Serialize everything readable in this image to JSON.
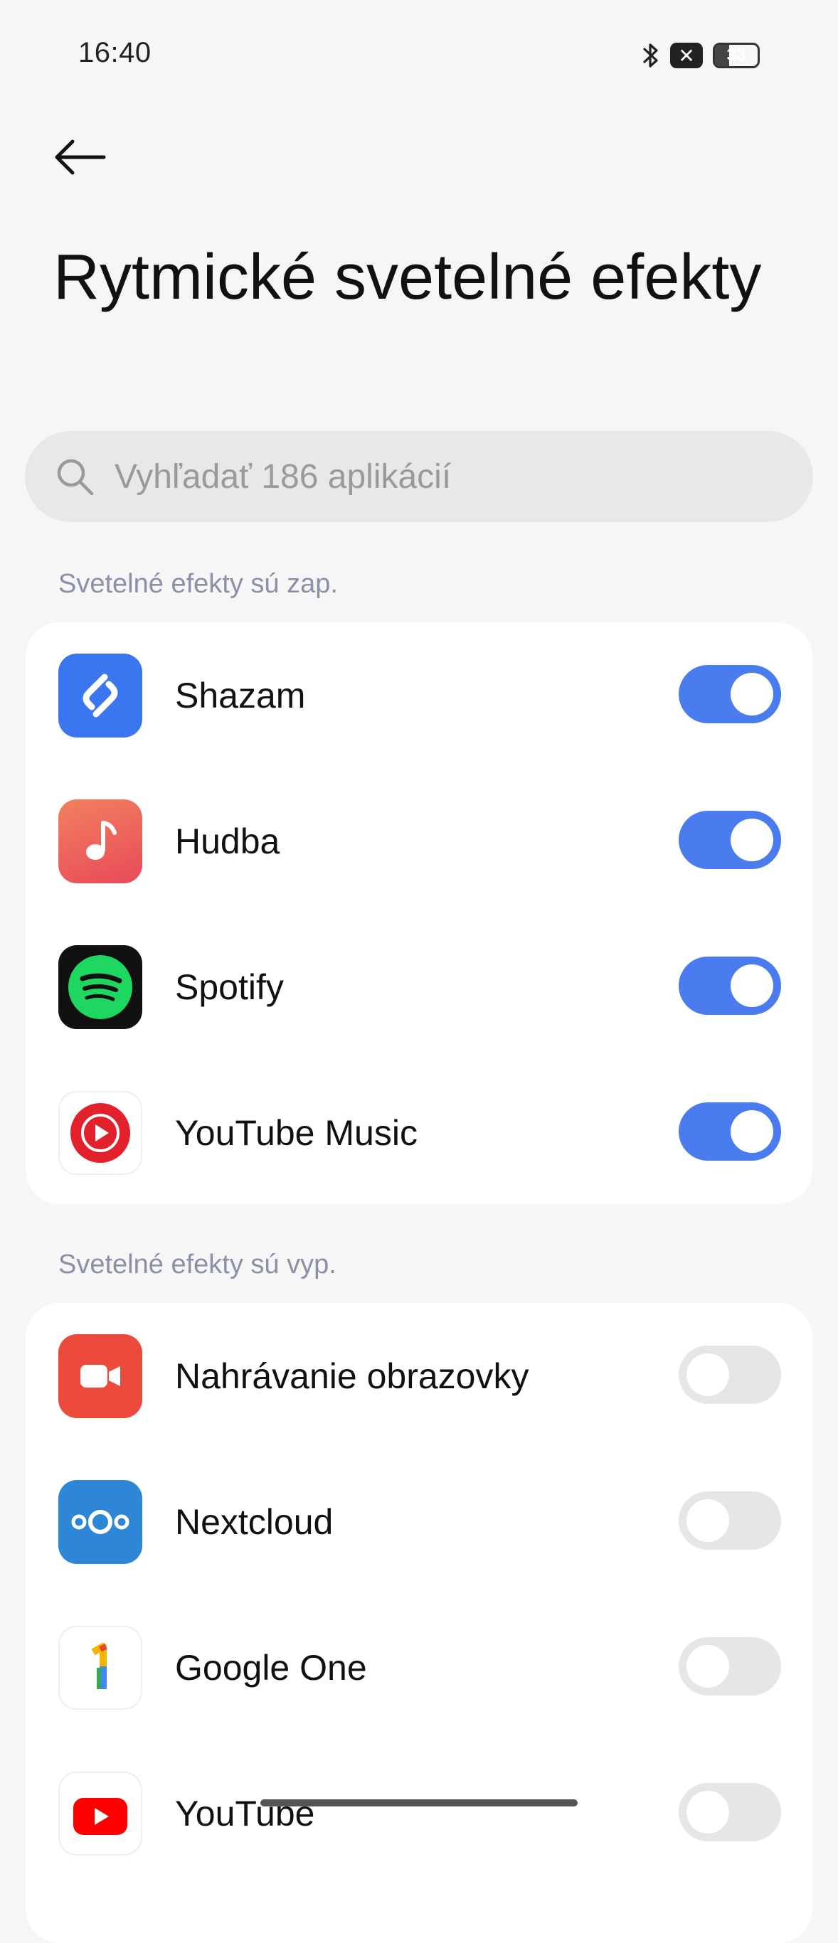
{
  "status_bar": {
    "time": "16:40",
    "icons": [
      "bluetooth-icon",
      "x-badge-icon",
      "battery-icon"
    ],
    "x_badge": "✕",
    "battery_level": "33"
  },
  "header": {
    "back_icon": "arrow-left-icon",
    "title": "Rytmické svetelné efekty"
  },
  "search": {
    "placeholder": "Vyhľadať 186 aplikácií",
    "icon": "search-icon"
  },
  "sections": {
    "on": {
      "label": "Svetelné efekty sú zap.",
      "apps": [
        {
          "name": "Shazam",
          "enabled": true,
          "icon": "shazam-icon"
        },
        {
          "name": "Hudba",
          "enabled": true,
          "icon": "music-note-icon"
        },
        {
          "name": "Spotify",
          "enabled": true,
          "icon": "spotify-icon"
        },
        {
          "name": "YouTube Music",
          "enabled": true,
          "icon": "youtube-music-icon"
        }
      ]
    },
    "off": {
      "label": "Svetelné efekty sú vyp.",
      "apps": [
        {
          "name": "Nahrávanie obrazovky",
          "enabled": false,
          "icon": "screen-recorder-icon"
        },
        {
          "name": "Nextcloud",
          "enabled": false,
          "icon": "nextcloud-icon"
        },
        {
          "name": "Google One",
          "enabled": false,
          "icon": "google-one-icon"
        },
        {
          "name": "YouTube",
          "enabled": false,
          "icon": "youtube-icon"
        }
      ]
    }
  },
  "colors": {
    "accent": "#4a7cf0",
    "toggle_off": "#e6e6e6",
    "section_label": "#8b8fa8",
    "background": "#f6f6f6"
  }
}
